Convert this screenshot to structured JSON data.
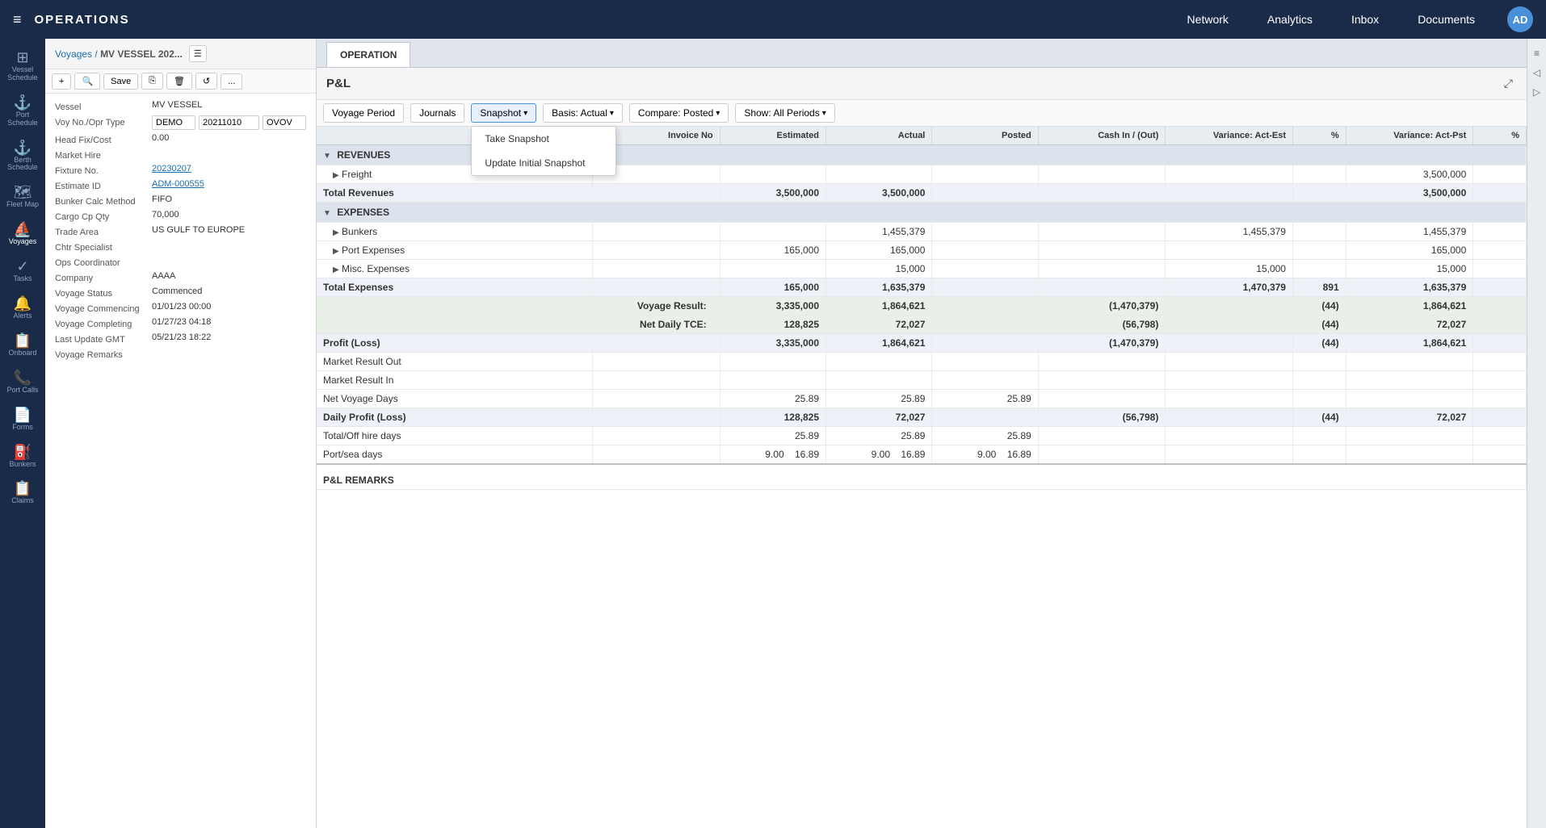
{
  "app": {
    "title": "OPERATIONS",
    "hamburger": "≡"
  },
  "top_nav": {
    "items": [
      "Network",
      "Analytics",
      "Inbox",
      "Documents"
    ],
    "avatar": "AD"
  },
  "sidebar_icons": [
    {
      "icon": "⊞",
      "label": "Vessel\nSchedule",
      "active": false
    },
    {
      "icon": "⚓",
      "label": "Port\nSchedule",
      "active": false
    },
    {
      "icon": "⚓",
      "label": "Berth\nSchedule",
      "active": false
    },
    {
      "icon": "🗺",
      "label": "Fleet Map",
      "active": false
    },
    {
      "icon": "⛵",
      "label": "Voyages",
      "active": true
    },
    {
      "icon": "✓",
      "label": "Tasks",
      "active": false
    },
    {
      "icon": "🔔",
      "label": "Alerts",
      "active": false
    },
    {
      "icon": "📋",
      "label": "Onboard",
      "active": false
    },
    {
      "icon": "📞",
      "label": "Port Calls",
      "active": false
    },
    {
      "icon": "📄",
      "label": "Forms",
      "active": false
    },
    {
      "icon": "⛽",
      "label": "Bunkers",
      "active": false
    },
    {
      "icon": "📋",
      "label": "Claims",
      "active": false
    }
  ],
  "left_panel": {
    "breadcrumb": "Voyages /",
    "title": "MV VESSEL 202...",
    "toolbar": {
      "add": "+",
      "search": "🔍",
      "save": "Save",
      "copy": "⎘",
      "delete": "🗑",
      "refresh": "↺",
      "more": "..."
    },
    "fields": [
      {
        "label": "Vessel",
        "value": "MV VESSEL",
        "type": "text"
      },
      {
        "label": "Voy No./Opr Type",
        "value1": "DEMO",
        "value2": "20211010",
        "value3": "OVOV",
        "type": "inline3"
      },
      {
        "label": "Head Fix/Cost",
        "value": "0.00",
        "type": "text"
      },
      {
        "label": "Market Hire",
        "value": "",
        "type": "text"
      },
      {
        "label": "Fixture No.",
        "value": "20230207",
        "type": "link"
      },
      {
        "label": "Estimate ID",
        "value": "ADM-000555",
        "type": "link"
      },
      {
        "label": "Bunker Calc Method",
        "value": "FIFO",
        "type": "text"
      },
      {
        "label": "Cargo Cp Qty",
        "value": "70,000",
        "type": "text"
      },
      {
        "label": "Trade Area",
        "value": "US GULF TO EUROPE",
        "type": "text"
      },
      {
        "label": "Chtr Specialist",
        "value": "",
        "type": "text"
      },
      {
        "label": "Ops Coordinator",
        "value": "",
        "type": "text"
      },
      {
        "label": "Company",
        "value": "AAAA",
        "type": "text"
      },
      {
        "label": "Voyage Status",
        "value": "Commenced",
        "type": "text"
      },
      {
        "label": "Voyage Commencing",
        "value": "01/01/23 00:00",
        "type": "text"
      },
      {
        "label": "Voyage Completing",
        "value": "01/27/23 04:18",
        "type": "text"
      },
      {
        "label": "Last Update GMT",
        "value": "05/21/23 18:22",
        "type": "text"
      },
      {
        "label": "Voyage Remarks",
        "value": "",
        "type": "text"
      }
    ]
  },
  "tabs": {
    "operation": "OPERATION",
    "active": "OPERATION"
  },
  "pnl": {
    "title": "P&L",
    "toolbar": {
      "voyage_period": "Voyage Period",
      "journals": "Journals",
      "snapshot": "Snapshot",
      "snapshot_caret": "▾",
      "basis": "Basis: Actual",
      "basis_caret": "▾",
      "compare": "Compare: Posted",
      "compare_caret": "▾",
      "show": "Show: All Periods",
      "show_caret": "▾"
    },
    "snapshot_dropdown": {
      "visible": true,
      "items": [
        "Take Snapshot",
        "Update Initial Snapshot"
      ]
    },
    "table": {
      "headers": [
        "",
        "Invoice No",
        "Estimated",
        "Actual",
        "Posted",
        "Cash In / (Out)",
        "Variance: Act-Est",
        "%",
        "Variance: Act-Pst",
        "%"
      ],
      "revenues": {
        "label": "REVENUES",
        "rows": [
          {
            "indent": 1,
            "label": "▶ Freight",
            "invoice_no": "",
            "estimated": "",
            "actual": "",
            "posted": "",
            "cash": "",
            "var_act_est": "",
            "pct1": "",
            "var_act_pst": "3,500,000",
            "pct2": ""
          }
        ],
        "total": {
          "label": "Total Revenues",
          "estimated": "3,500,000",
          "actual": "3,500,000",
          "posted": "",
          "cash": "",
          "var_act_est": "",
          "pct1": "",
          "var_act_pst": "3,500,000",
          "pct2": ""
        }
      },
      "expenses": {
        "label": "EXPENSES",
        "rows": [
          {
            "indent": 1,
            "label": "▶ Bunkers",
            "invoice_no": "",
            "estimated": "",
            "actual": "1,455,379",
            "posted": "",
            "cash": "",
            "var_act_est": "1,455,379",
            "pct1": "",
            "var_act_pst": "1,455,379",
            "pct2": ""
          },
          {
            "indent": 1,
            "label": "▶ Port Expenses",
            "invoice_no": "",
            "estimated": "165,000",
            "actual": "165,000",
            "posted": "",
            "cash": "",
            "var_act_est": "",
            "pct1": "",
            "var_act_pst": "165,000",
            "pct2": ""
          },
          {
            "indent": 1,
            "label": "▶ Misc. Expenses",
            "invoice_no": "",
            "estimated": "",
            "actual": "15,000",
            "posted": "",
            "cash": "",
            "var_act_est": "15,000",
            "pct1": "",
            "var_act_pst": "15,000",
            "pct2": ""
          }
        ],
        "total": {
          "label": "Total Expenses",
          "estimated": "165,000",
          "actual": "1,635,379",
          "posted": "",
          "cash": "",
          "var_act_est": "1,470,379",
          "pct1": "891",
          "var_act_pst": "1,635,379",
          "pct2": ""
        }
      },
      "voyage_result": {
        "label": "Voyage Result:",
        "estimated": "3,335,000",
        "actual": "1,864,621",
        "posted": "",
        "cash": "(1,470,379)",
        "var_act_est": "",
        "pct1": "(44)",
        "var_act_pst": "1,864,621",
        "pct2": ""
      },
      "net_daily_tce": {
        "label": "Net Daily TCE:",
        "estimated": "128,825",
        "actual": "72,027",
        "posted": "",
        "cash": "(56,798)",
        "pct1": "(44)",
        "var_act_pst": "72,027",
        "pct2": ""
      },
      "profit_loss": {
        "label": "Profit (Loss)",
        "estimated": "3,335,000",
        "actual": "1,864,621",
        "posted": "",
        "cash": "(1,470,379)",
        "pct1": "(44)",
        "var_act_pst": "1,864,621",
        "pct2": ""
      },
      "market_result_out": {
        "label": "Market Result Out"
      },
      "market_result_in": {
        "label": "Market Result In"
      },
      "net_voyage_days": {
        "label": "Net Voyage Days",
        "estimated": "25.89",
        "actual": "25.89",
        "posted": "25.89"
      },
      "daily_profit_loss": {
        "label": "Daily Profit (Loss)",
        "estimated": "128,825",
        "actual": "72,027",
        "posted": "",
        "cash": "(56,798)",
        "pct1": "(44)",
        "var_act_pst": "72,027",
        "pct2": ""
      },
      "total_offhire_days": {
        "label": "Total/Off hire days",
        "estimated": "25.89",
        "actual": "25.89",
        "posted": "25.89"
      },
      "port_sea_days": {
        "label": "Port/sea days",
        "est1": "9.00",
        "est2": "16.89",
        "act1": "9.00",
        "act2": "16.89",
        "pst1": "9.00",
        "pst2": "16.89"
      }
    },
    "remarks_label": "P&L REMARKS"
  }
}
